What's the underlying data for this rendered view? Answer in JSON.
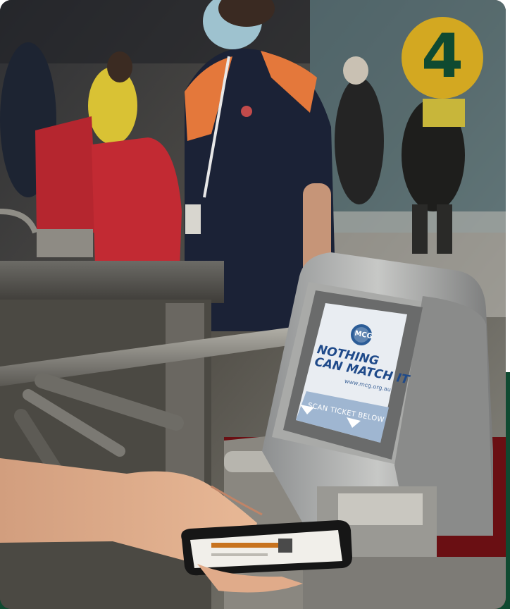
{
  "badge": {
    "number": "4",
    "color": "#d3a821",
    "text_color": "#0f4a31"
  },
  "scanner_screen": {
    "logo": "MCG",
    "slogan_line1": "NOTHING",
    "slogan_line2": "CAN MATCH IT",
    "website": "www.mcg.org.au",
    "instruction": "SCAN TICKET BELOW"
  },
  "colors": {
    "band_green": "#0f4a31",
    "badge_gold": "#d3a821"
  }
}
